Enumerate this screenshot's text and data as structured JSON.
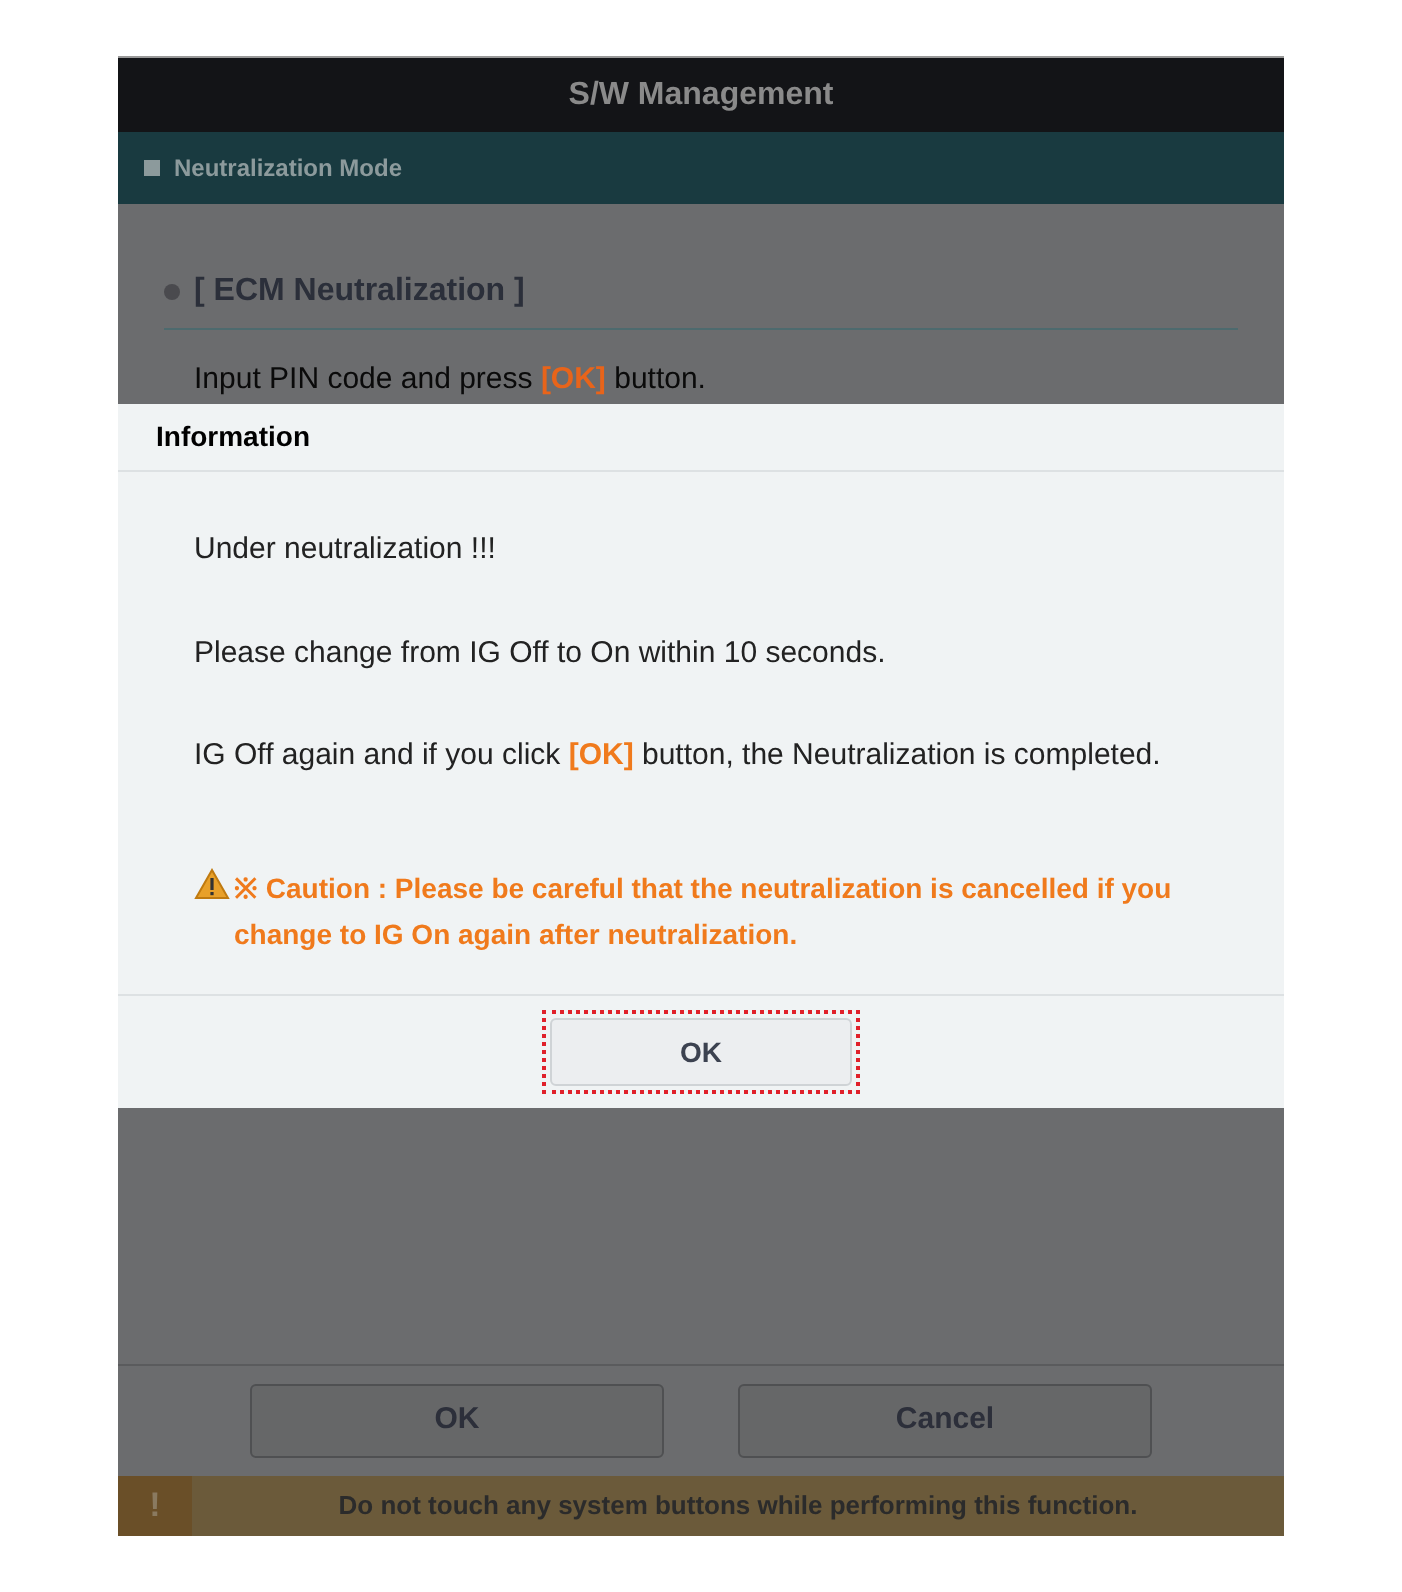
{
  "window": {
    "title": "S/W Management"
  },
  "section": {
    "title": "Neutralization Mode"
  },
  "heading": "[ ECM Neutralization ]",
  "instruction": {
    "before": "Input PIN code and press ",
    "highlight": "[OK]",
    "after": " button."
  },
  "buttons": [
    "OK",
    "Cancel"
  ],
  "warning_bar": {
    "icon": "!",
    "text": "Do not touch any system buttons while performing this function."
  },
  "dialog": {
    "title": "Information",
    "lines": [
      {
        "before": "Under neutralization !!!"
      },
      {
        "before": "Please change from IG Off to On within 10 seconds."
      },
      {
        "before": "IG Off again and if you click ",
        "highlight": "[OK]",
        "after": " button, the Neutralization is completed."
      }
    ],
    "caution": "※ Caution : Please be careful that the neutralization is cancelled if you change to IG On again after neutralization.",
    "button": {
      "label": "OK",
      "highlighted": true
    }
  }
}
